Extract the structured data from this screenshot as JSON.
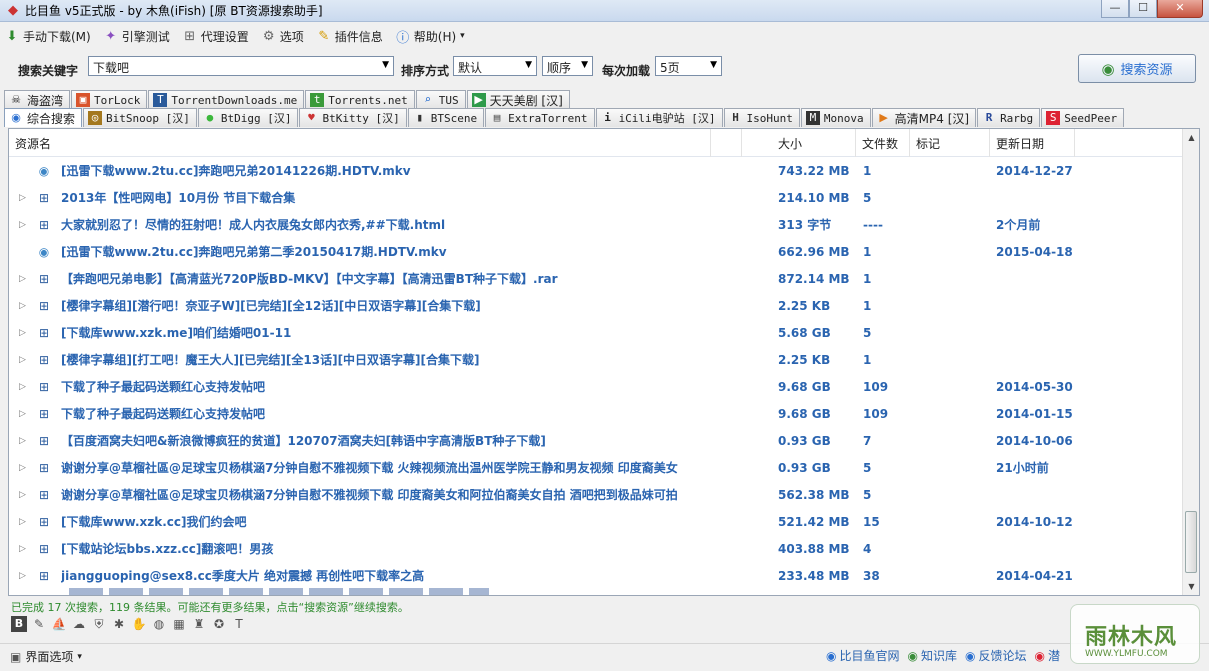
{
  "window": {
    "title": "比目鱼 v5正式版 - by 木魚(iFish) [原 BT资源搜索助手]",
    "buttons": [
      "—",
      "☐",
      "✕"
    ]
  },
  "menu": [
    {
      "label": "手动下载(M)",
      "icon": "down-arrow-icon"
    },
    {
      "label": "引擎测试",
      "icon": "wand-icon"
    },
    {
      "label": "代理设置",
      "icon": "proxy-icon"
    },
    {
      "label": "选项",
      "icon": "gear-icon"
    },
    {
      "label": "插件信息",
      "icon": "plugin-icon"
    },
    {
      "label": "帮助(H)",
      "icon": "info-icon",
      "chevron": "▾"
    }
  ],
  "search": {
    "keyword_label": "搜索关键字",
    "keyword_value": "下载吧",
    "sort_label": "排序方式",
    "sort_value": "默认",
    "order_value": "顺序",
    "load_label": "每次加载",
    "load_value": "5页",
    "button_label": "搜索资源"
  },
  "tabs_row1": [
    {
      "label": "海盗湾",
      "icon": "pirate-icon",
      "cjk": true
    },
    {
      "label": "TorLock",
      "icon": "torlock-icon"
    },
    {
      "label": "TorrentDownloads.me",
      "icon": "td-icon"
    },
    {
      "label": "Torrents.net",
      "icon": "torrents-icon"
    },
    {
      "label": "TUS",
      "icon": "tus-icon"
    },
    {
      "label": "天天美剧 [汉]",
      "icon": "tv-icon",
      "cjk": true
    }
  ],
  "tabs_row2": [
    {
      "label": "综合搜索",
      "icon": "globe-icon",
      "cjk": true,
      "active": true
    },
    {
      "label": "BitSnoop [汉]",
      "icon": "bitsnoop-icon"
    },
    {
      "label": "BtDigg [汉]",
      "icon": "btdigg-icon"
    },
    {
      "label": "BtKitty [汉]",
      "icon": "btkitty-icon"
    },
    {
      "label": "BTScene",
      "icon": "btscene-icon"
    },
    {
      "label": "ExtraTorrent",
      "icon": "extratorrent-icon"
    },
    {
      "label": "iCili电驴站 [汉]",
      "icon": "icili-icon"
    },
    {
      "label": "IsoHunt",
      "icon": "isohunt-icon"
    },
    {
      "label": "Monova",
      "icon": "monova-icon"
    },
    {
      "label": "高清MP4 [汉]",
      "icon": "mp4-icon",
      "cjk": true
    },
    {
      "label": "Rarbg",
      "icon": "rarbg-icon"
    },
    {
      "label": "SeedPeer",
      "icon": "seedpeer-icon"
    }
  ],
  "table": {
    "columns": [
      "资源名",
      "大小",
      "文件数",
      "标记",
      "更新日期"
    ],
    "rows": [
      {
        "name": "[迅雷下载www.2tu.cc]奔跑吧兄弟20141226期.HDTV.mkv",
        "size": "743.22 MB",
        "files": "1",
        "date": "2014-12-27",
        "type": "file"
      },
      {
        "name": "2013年【性吧网电】10月份 节目下载合集",
        "size": "214.10 MB",
        "files": "5",
        "date": "",
        "type": "folder"
      },
      {
        "name": "大家就别忍了！尽情的狂射吧！成人内衣展兔女郎内衣秀,##下载.html",
        "size": "313 字节",
        "files": "----",
        "date": "2个月前",
        "type": "folder"
      },
      {
        "name": "[迅雷下载www.2tu.cc]奔跑吧兄弟第二季20150417期.HDTV.mkv",
        "size": "662.96 MB",
        "files": "1",
        "date": "2015-04-18",
        "type": "file"
      },
      {
        "name": "【奔跑吧兄弟电影】【高清蓝光720P版BD-MKV】【中文字幕】【高清迅雷BT种子下载】.rar",
        "size": "872.14 MB",
        "files": "1",
        "date": "",
        "type": "folder"
      },
      {
        "name": "[樱律字幕组][潜行吧！奈亚子W][已完结][全12话][中日双语字幕][合集下载]",
        "size": "2.25 KB",
        "files": "1",
        "date": "",
        "type": "folder"
      },
      {
        "name": "[下载库www.xzk.me]咱们结婚吧01-11",
        "size": "5.68 GB",
        "files": "5",
        "date": "",
        "type": "folder"
      },
      {
        "name": "[樱律字幕组][打工吧！魔王大人][已完结][全13话][中日双语字幕][合集下载]",
        "size": "2.25 KB",
        "files": "1",
        "date": "",
        "type": "folder"
      },
      {
        "name": "下载了种子最起码送颗红心支持发帖吧",
        "size": "9.68 GB",
        "files": "109",
        "date": "2014-05-30",
        "type": "folder"
      },
      {
        "name": "下载了种子最起码送颗红心支持发帖吧",
        "size": "9.68 GB",
        "files": "109",
        "date": "2014-01-15",
        "type": "folder"
      },
      {
        "name": "【百度酒窝夫妇吧&新浪微博疯狂的贫道】120707酒窝夫妇[韩语中字高清版BT种子下载]",
        "size": "0.93 GB",
        "files": "7",
        "date": "2014-10-06",
        "type": "folder"
      },
      {
        "name": "谢谢分享@草榴社區@足球宝贝杨棋涵7分钟自慰不雅视频下载 火辣视频流出温州医学院王静和男友视频 印度裔美女",
        "size": "0.93 GB",
        "files": "5",
        "date": "21小时前",
        "type": "folder"
      },
      {
        "name": "谢谢分享@草榴社區@足球宝贝杨棋涵7分钟自慰不雅视频下载 印度裔美女和阿拉伯裔美女自拍 酒吧把到极品妹可拍",
        "size": "562.38 MB",
        "files": "5",
        "date": "",
        "type": "folder"
      },
      {
        "name": "[下载库www.xzk.cc]我们约会吧",
        "size": "521.42 MB",
        "files": "15",
        "date": "2014-10-12",
        "type": "folder"
      },
      {
        "name": "[下载站论坛bbs.xzz.cc]翻滚吧！男孩",
        "size": "403.88 MB",
        "files": "4",
        "date": "",
        "type": "folder"
      },
      {
        "name": "jiangguoping@sex8.cc季度大片 绝对震撼 再创性吧下载率之高",
        "size": "233.48 MB",
        "files": "38",
        "date": "2014-04-21",
        "type": "folder"
      }
    ]
  },
  "status": "已完成 17 次搜索，119 条结果。可能还有更多结果，点击“搜索资源”继续搜索。",
  "bottom": {
    "ui_options": "界面选项",
    "links": [
      {
        "label": "比目鱼官网",
        "icon": "globe-icon"
      },
      {
        "label": "知识库",
        "icon": "book-icon"
      },
      {
        "label": "反馈论坛",
        "icon": "forum-icon"
      },
      {
        "label": "潜",
        "icon": "weibo-icon"
      }
    ]
  },
  "watermark": {
    "title": "雨林木风",
    "url": "WWW.YLMFU.COM"
  },
  "colors": {
    "link_blue": "#2a64b0",
    "status_green": "#2e8b2e"
  }
}
